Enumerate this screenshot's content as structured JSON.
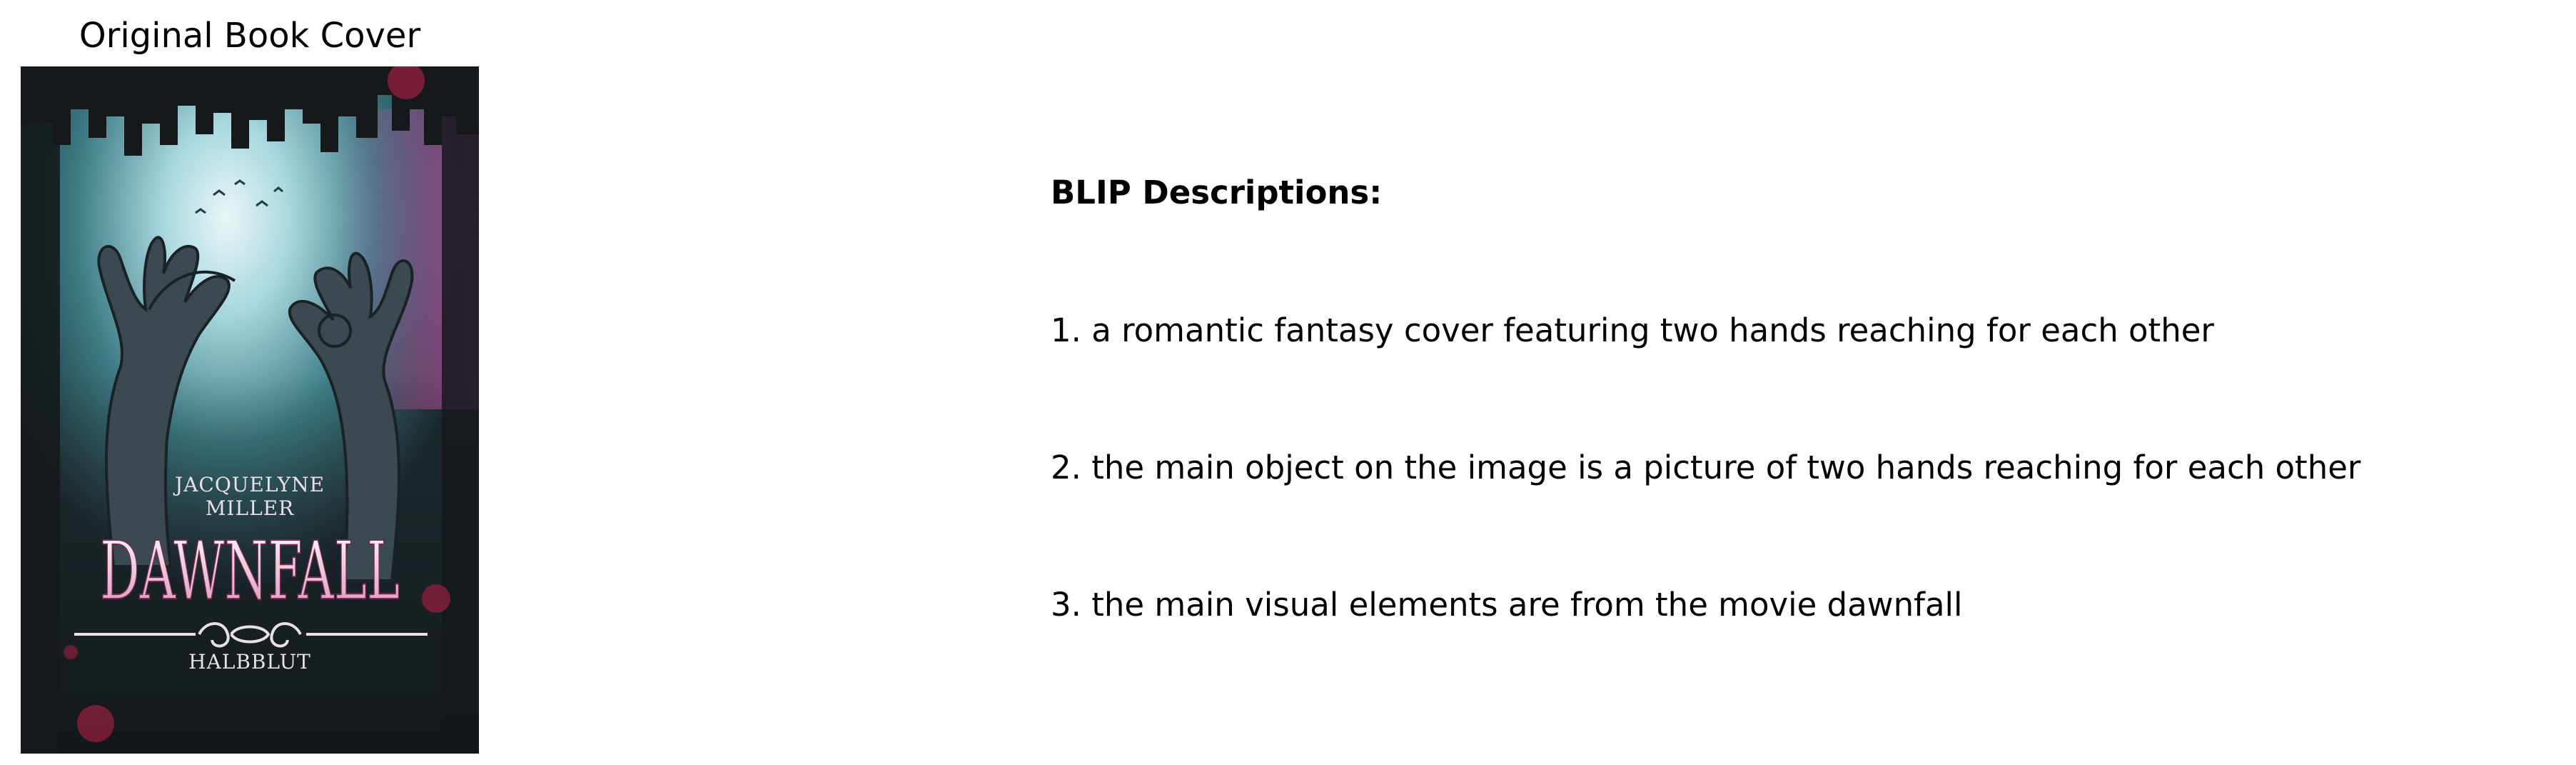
{
  "panel_title": "Original Book Cover",
  "cover": {
    "author_line1": "JACQUELYNE",
    "author_line2": "MILLER",
    "title": "DAWNFALL",
    "subtitle": "HALBBLUT",
    "colors": {
      "sky": "#a9d8e0",
      "teal": "#3d7c86",
      "magenta": "#b04e9a",
      "dark": "#1b1f22",
      "title_pink": "#f3d6e2"
    }
  },
  "descriptions": {
    "heading": "BLIP Descriptions:",
    "items": [
      "1. a romantic fantasy cover featuring two hands reaching for each other",
      "2. the main object on the image is a picture of two hands reaching for each other",
      "3. the main visual elements are from the movie dawnfall"
    ]
  }
}
